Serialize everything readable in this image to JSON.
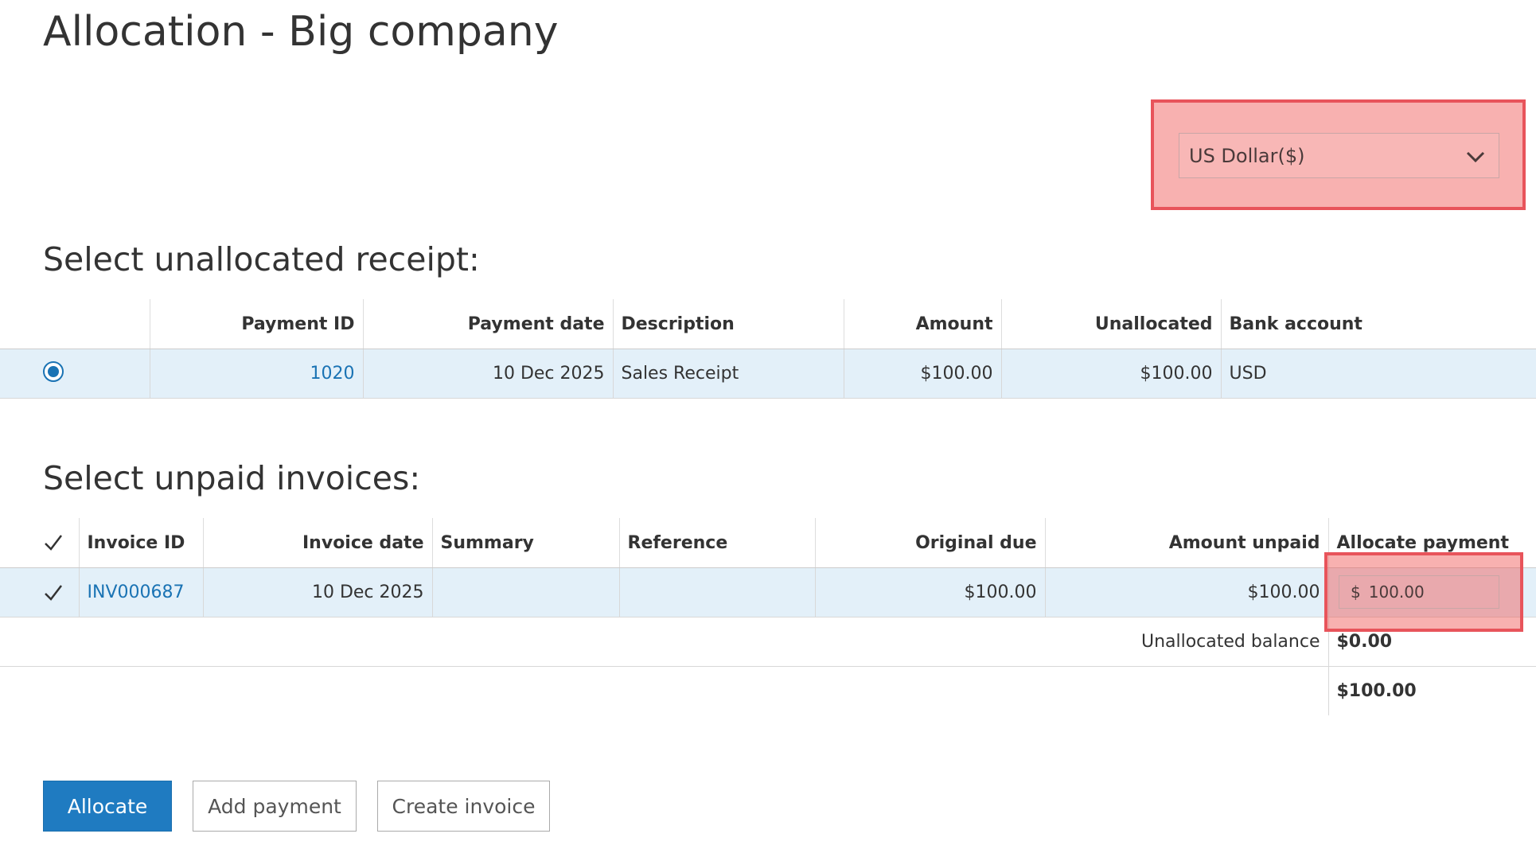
{
  "page": {
    "title": "Allocation - Big company"
  },
  "currency": {
    "selected": "US Dollar($)"
  },
  "receipts": {
    "heading": "Select unallocated receipt:",
    "columns": [
      "Payment ID",
      "Payment date",
      "Description",
      "Amount",
      "Unallocated",
      "Bank account"
    ],
    "rows": [
      {
        "payment_id": "1020",
        "payment_date": "10 Dec 2025",
        "description": "Sales Receipt",
        "amount": "$100.00",
        "unallocated": "$100.00",
        "bank_account": "USD",
        "selected": true
      }
    ]
  },
  "invoices": {
    "heading": "Select unpaid invoices:",
    "columns": [
      "Invoice ID",
      "Invoice date",
      "Summary",
      "Reference",
      "Original due",
      "Amount unpaid",
      "Allocate payment"
    ],
    "rows": [
      {
        "invoice_id": "INV000687",
        "invoice_date": "10 Dec 2025",
        "summary": "",
        "reference": "",
        "original_due": "$100.00",
        "amount_unpaid": "$100.00",
        "allocate_currency": "$",
        "allocate_value": "100.00",
        "checked": true
      }
    ],
    "unallocated_balance_label": "Unallocated balance",
    "unallocated_balance_value": "$0.00",
    "total_value": "$100.00"
  },
  "buttons": {
    "allocate": "Allocate",
    "add_payment": "Add payment",
    "create_invoice": "Create invoice"
  },
  "colors": {
    "accent": "#1f7bc1",
    "link": "#1a73b4",
    "row_highlight": "#e3f0f9",
    "annotation": "#e8545b"
  }
}
